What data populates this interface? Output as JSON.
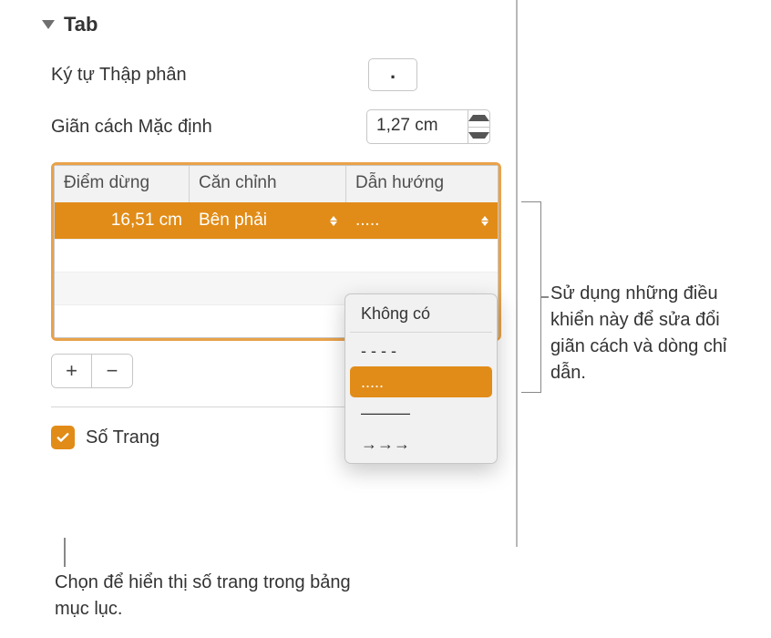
{
  "section": {
    "title": "Tab"
  },
  "decimal": {
    "label": "Ký tự Thập phân",
    "value": "."
  },
  "spacing": {
    "label": "Giãn cách Mặc định",
    "value": "1,27 cm"
  },
  "table": {
    "headers": {
      "stops": "Điểm dừng",
      "align": "Căn chỉnh",
      "leader": "Dẫn hướng"
    },
    "row": {
      "stop": "16,51 cm",
      "align": "Bên phải",
      "leader": "....."
    }
  },
  "leader_menu": {
    "none": "Không có",
    "dash": "- - - -",
    "dots": ".....",
    "line": "———",
    "arrows": "→→→"
  },
  "buttons": {
    "add": "+",
    "remove": "−"
  },
  "pagenum": {
    "label": "Số Trang"
  },
  "callouts": {
    "right": "Sử dụng những điều khiển này để sửa đổi giãn cách và dòng chỉ dẫn.",
    "bottom": "Chọn để hiển thị số trang trong bảng mục lục."
  }
}
